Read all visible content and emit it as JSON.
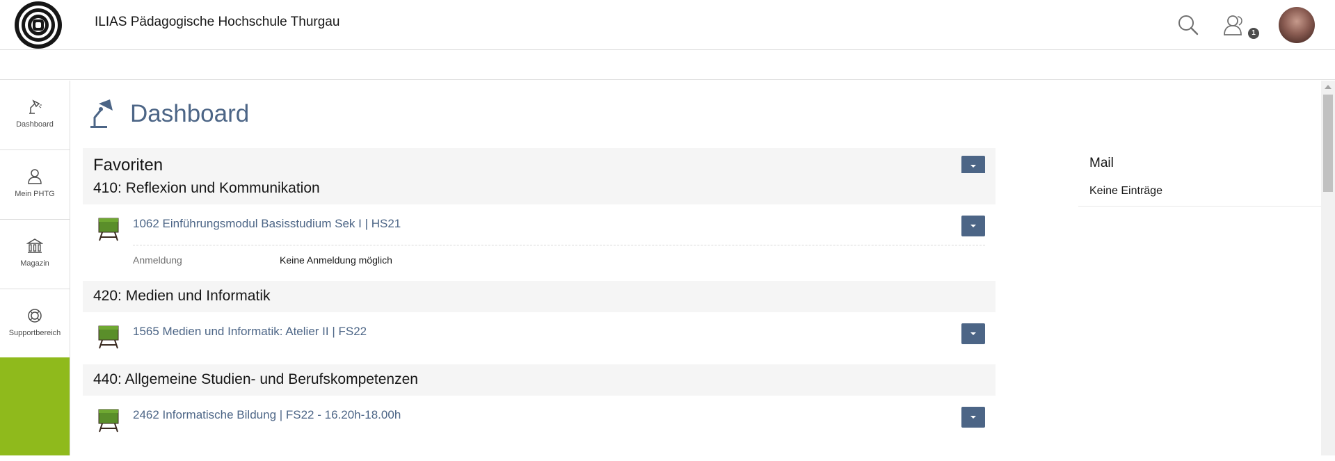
{
  "header": {
    "site_title": "ILIAS Pädagogische Hochschule Thurgau",
    "contacts_badge": "1"
  },
  "mainbar": {
    "items": [
      {
        "label": "Dashboard",
        "icon": "lamp-icon"
      },
      {
        "label": "Mein PHTG",
        "icon": "user-icon"
      },
      {
        "label": "Magazin",
        "icon": "bank-icon"
      },
      {
        "label": "Supportbereich",
        "icon": "lifebuoy-icon"
      }
    ],
    "accent_color": "#8fba1c"
  },
  "page": {
    "title": "Dashboard"
  },
  "favorites": {
    "title": "Favoriten",
    "groups": [
      {
        "title": "410: Reflexion und Kommunikation",
        "items": [
          {
            "title": "1062 Einführungsmodul Basisstudium Sek I | HS21",
            "prop_label": "Anmeldung",
            "prop_value": "Keine Anmeldung möglich"
          }
        ]
      },
      {
        "title": "420: Medien und Informatik",
        "items": [
          {
            "title": "1565 Medien und Informatik: Atelier II | FS22"
          }
        ]
      },
      {
        "title": "440: Allgemeine Studien- und Berufskompetenzen",
        "items": [
          {
            "title": "2462 Informatische Bildung | FS22 - 16.20h-18.00h"
          }
        ]
      }
    ]
  },
  "mail": {
    "title": "Mail",
    "empty_text": "Keine Einträge"
  },
  "colors": {
    "link": "#4c6586",
    "button": "#4c6586",
    "panel_bg": "#f5f5f5"
  }
}
